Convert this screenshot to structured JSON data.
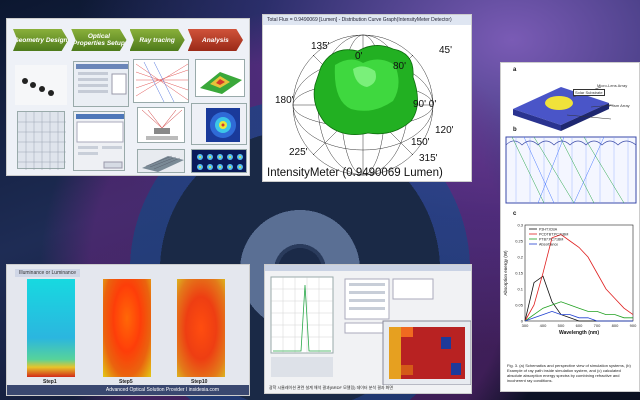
{
  "workflow": {
    "steps": [
      "Geometry Design",
      "Optical Properties Setup",
      "Ray tracing",
      "Analysis"
    ]
  },
  "intensity": {
    "title": "Total Flux = 0.9490069 [Lumen] - Distribution Curve Graph(IntensityMeter Detector)",
    "angles": [
      "135'",
      "0'",
      "45'",
      "80'",
      "90' 0'",
      "180'",
      "120'",
      "150'",
      "225'",
      "315'"
    ],
    "meter_label": "IntensityMeter (0.9490069 Lumen)"
  },
  "paper": {
    "labels": [
      "a",
      "b",
      "c"
    ],
    "diagram_labels": [
      "Micro-Lens Array",
      "Prism Array",
      "Solar Substrate"
    ],
    "chart_data": {
      "type": "line",
      "title": "",
      "xlabel": "Wavelength (nm)",
      "ylabel": "Absorption energy (W)",
      "xlim": [
        300,
        900
      ],
      "ylim": [
        0,
        0.3
      ],
      "xticks": [
        300,
        400,
        500,
        600,
        700,
        800,
        900
      ],
      "yticks": [
        0,
        0.05,
        0.1,
        0.15,
        0.2,
        0.25,
        0.3
      ],
      "x": [
        300,
        350,
        400,
        450,
        500,
        550,
        600,
        650,
        700,
        750,
        800,
        850,
        900
      ],
      "series": [
        {
          "name": "P3HT:ICBA",
          "values": [
            0.0,
            0.12,
            0.14,
            0.06,
            0.02,
            0.01,
            0.0,
            0.0,
            0.0,
            0.0,
            0.0,
            0.0,
            0.0
          ]
        },
        {
          "name": "PCDTBT:PC71BM",
          "values": [
            0.0,
            0.05,
            0.15,
            0.26,
            0.27,
            0.25,
            0.23,
            0.2,
            0.15,
            0.1,
            0.07,
            0.04,
            0.02
          ]
        },
        {
          "name": "PTB7:PC71BM",
          "values": [
            0.0,
            0.02,
            0.04,
            0.05,
            0.06,
            0.05,
            0.04,
            0.03,
            0.03,
            0.02,
            0.02,
            0.01,
            0.01
          ]
        },
        {
          "name": "Absorbance",
          "values": [
            0.0,
            0.01,
            0.02,
            0.03,
            0.02,
            0.02,
            0.01,
            0.01,
            0.0,
            0.0,
            0.0,
            0.0,
            0.0
          ]
        }
      ]
    },
    "caption": "Fig. 3. (a) Schematics and perspective view of simulation systems, (b) Example of ray path inside simulation system, and (c) calculated absolute absorption energy spectra by combining refractive and incoherent ray conditions."
  },
  "heatmaps": {
    "header": "Illuminance or Luminance",
    "labels": [
      "Step1",
      "Step5",
      "Step10"
    ],
    "footer": "Advanced Optical Solution Provider I insidesia.com"
  },
  "software": {
    "caption": "광학 시뮬레이션 관련 설계 해석 결과(BRDF 모델링) 데이터 분석 결과 화면"
  }
}
